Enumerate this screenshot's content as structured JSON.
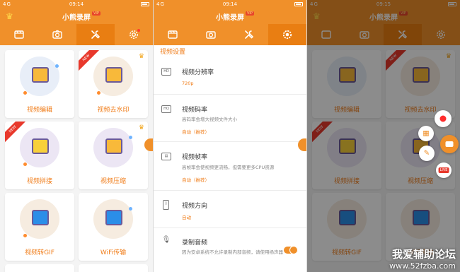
{
  "status": {
    "signal": "4G",
    "time_a": "09:14",
    "time_b": "09:14",
    "time_c": "09:15"
  },
  "app": {
    "title": "小熊录屏",
    "vip_badge": "VIP",
    "crown_icon": "crown-icon"
  },
  "tabs": [
    {
      "icon": "video-record-icon"
    },
    {
      "icon": "camera-icon"
    },
    {
      "icon": "tools-icon"
    },
    {
      "icon": "gear-icon"
    }
  ],
  "tools": [
    {
      "label": "视频编辑",
      "new": false,
      "vip": false,
      "icon_color": "#f8b93a"
    },
    {
      "label": "视频去水印",
      "new": true,
      "vip": true,
      "icon_color": "#f8b93a"
    },
    {
      "label": "视频拼接",
      "new": true,
      "vip": false,
      "icon_color": "#f8d03a"
    },
    {
      "label": "视频压缩",
      "new": false,
      "vip": true,
      "icon_color": "#f8b93a"
    },
    {
      "label": "视频转GIF",
      "new": false,
      "vip": false,
      "icon_color": "#2b8ee8"
    },
    {
      "label": "WiFi传输",
      "new": false,
      "vip": false,
      "icon_color": "#2b8ee8"
    }
  ],
  "new_badge": "NEW",
  "settings": {
    "section": "视频设置",
    "items": [
      {
        "icon_text": "HD",
        "title": "视频分辨率",
        "value": "720p",
        "desc": ""
      },
      {
        "icon_text": "HQ",
        "title": "视频码率",
        "desc": "高码率会增大视频文件大小",
        "value": "自动（推荐）"
      },
      {
        "icon_text": "▤",
        "title": "视频帧率",
        "desc": "高帧率会使视频更流畅，但需要更多CPU资源",
        "value": "自动（推荐）"
      },
      {
        "icon_text": "▯",
        "title": "视频方向",
        "desc": "",
        "value": "自动"
      },
      {
        "icon_text": "🎙",
        "title": "录制音频",
        "desc": "因为安卓系统不允许录制内部音频，请使用扬声器",
        "value": ""
      }
    ]
  },
  "floating_menu": {
    "record_icon": "record-dot-icon",
    "tools_icon": "tools-grid-icon",
    "camera_icon": "camera-record-icon",
    "brush_icon": "brush-icon",
    "live_label": "LIVE"
  },
  "watermark": {
    "line1": "我爱辅助论坛",
    "line2": "www.52fzba.com"
  },
  "colors": {
    "accent": "#f0902a",
    "accent_dark": "#e97e12",
    "label": "#f07d1a"
  }
}
